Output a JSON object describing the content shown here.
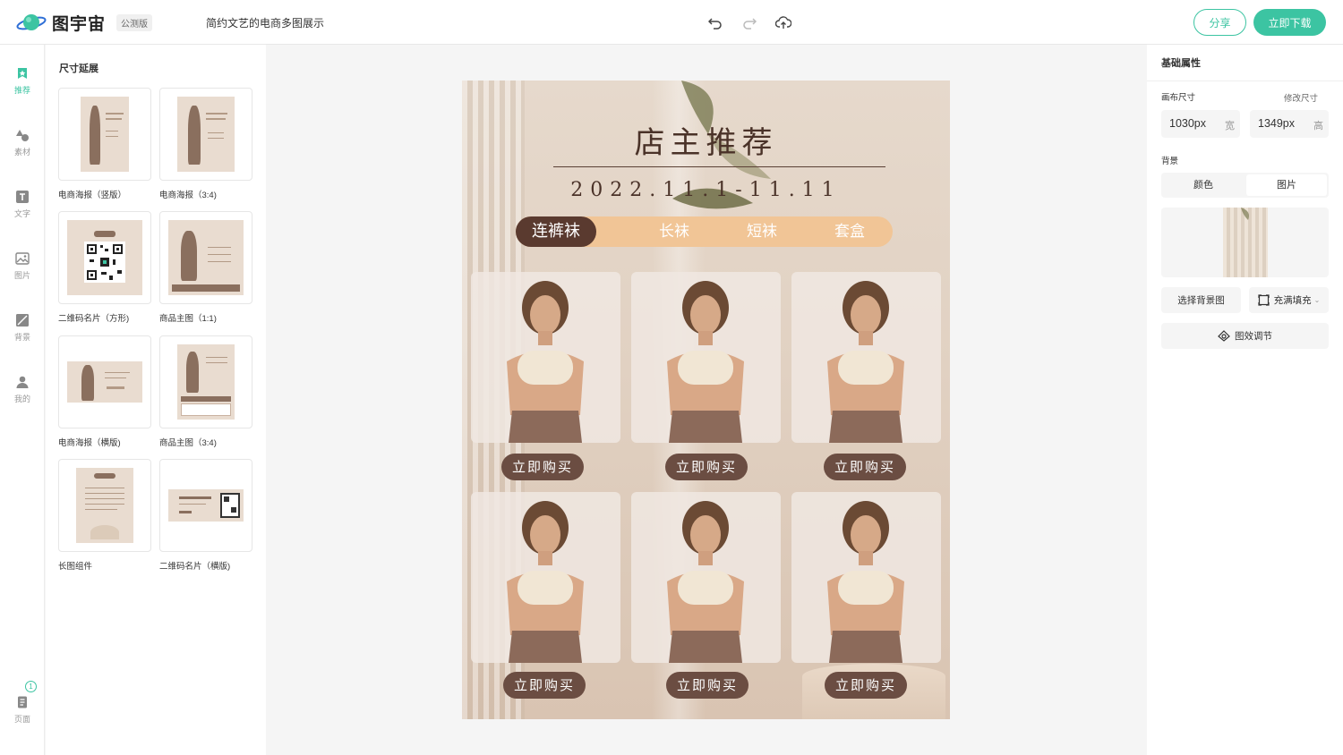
{
  "app": {
    "name": "图宇宙",
    "badge": "公测版",
    "document_title": "简约文艺的电商多图展示"
  },
  "toolbar": {
    "undo_icon": "undo-icon",
    "redo_icon": "redo-icon",
    "cloud_icon": "cloud-save-icon",
    "share_label": "分享",
    "download_label": "立即下载"
  },
  "nav": {
    "items": [
      {
        "label": "推荐",
        "icon": "recommend-icon",
        "active": true
      },
      {
        "label": "素材",
        "icon": "shapes-icon"
      },
      {
        "label": "文字",
        "icon": "text-icon"
      },
      {
        "label": "图片",
        "icon": "image-icon"
      },
      {
        "label": "背景",
        "icon": "background-icon"
      },
      {
        "label": "我的",
        "icon": "user-icon"
      }
    ],
    "pages": {
      "label": "页面",
      "count": "1",
      "icon": "pages-icon"
    }
  },
  "panel": {
    "title": "尺寸延展",
    "templates": [
      {
        "label": "电商海报（竖版）"
      },
      {
        "label": "电商海报（3:4)"
      },
      {
        "label": "二维码名片（方形)"
      },
      {
        "label": "商品主图（1:1)"
      },
      {
        "label": "电商海报（横版)"
      },
      {
        "label": "商品主图（3:4)"
      },
      {
        "label": "长图组件"
      },
      {
        "label": "二维码名片（横版)"
      }
    ]
  },
  "poster": {
    "title": "店主推荐",
    "date": "2022.11.1-11.11",
    "tabs": [
      "连裤袜",
      "长袜",
      "短袜",
      "套盒"
    ],
    "buy_label": "立即购买",
    "colors": {
      "accent": "#5a3a2f",
      "tabbar": "#f1c596",
      "button": "#6b4d42"
    }
  },
  "properties": {
    "title": "基础属性",
    "canvas_size_label": "画布尺寸",
    "modify_size_label": "修改尺寸",
    "width_value": "1030px",
    "width_unit": "宽",
    "height_value": "1349px",
    "height_unit": "高",
    "background_label": "背景",
    "bg_tabs": [
      "颜色",
      "图片"
    ],
    "choose_bg_label": "选择背景图",
    "fill_label": "充满填充",
    "adjust_label": "图效调节"
  },
  "theme": {
    "brand": "#3cc4a2"
  }
}
